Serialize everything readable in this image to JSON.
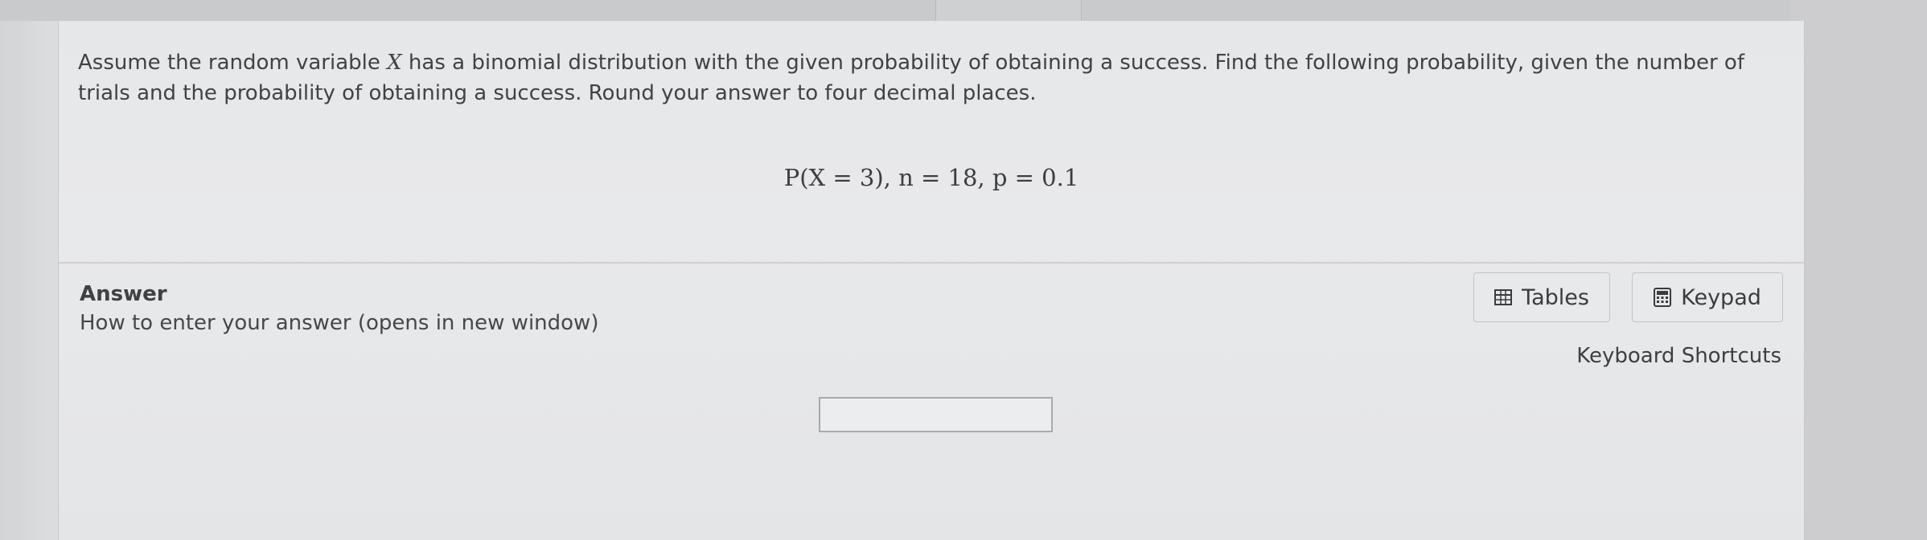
{
  "question": {
    "text_before_var": "Assume the random variable ",
    "variable": "X",
    "text_after_var": " has a binomial distribution with the given probability of obtaining a success. Find the following probability, given the number of trials and the probability of obtaining a success. Round your answer to four decimal places."
  },
  "formula": "P(X = 3), n = 18, p = 0.1",
  "answer": {
    "label": "Answer",
    "help_link": "How to enter your answer (opens in new window)",
    "input_value": ""
  },
  "tools": {
    "tables_label": "Tables",
    "tables_icon": "table-icon",
    "keypad_label": "Keypad",
    "keypad_icon": "calculator-icon",
    "shortcuts_label": "Keyboard Shortcuts"
  }
}
